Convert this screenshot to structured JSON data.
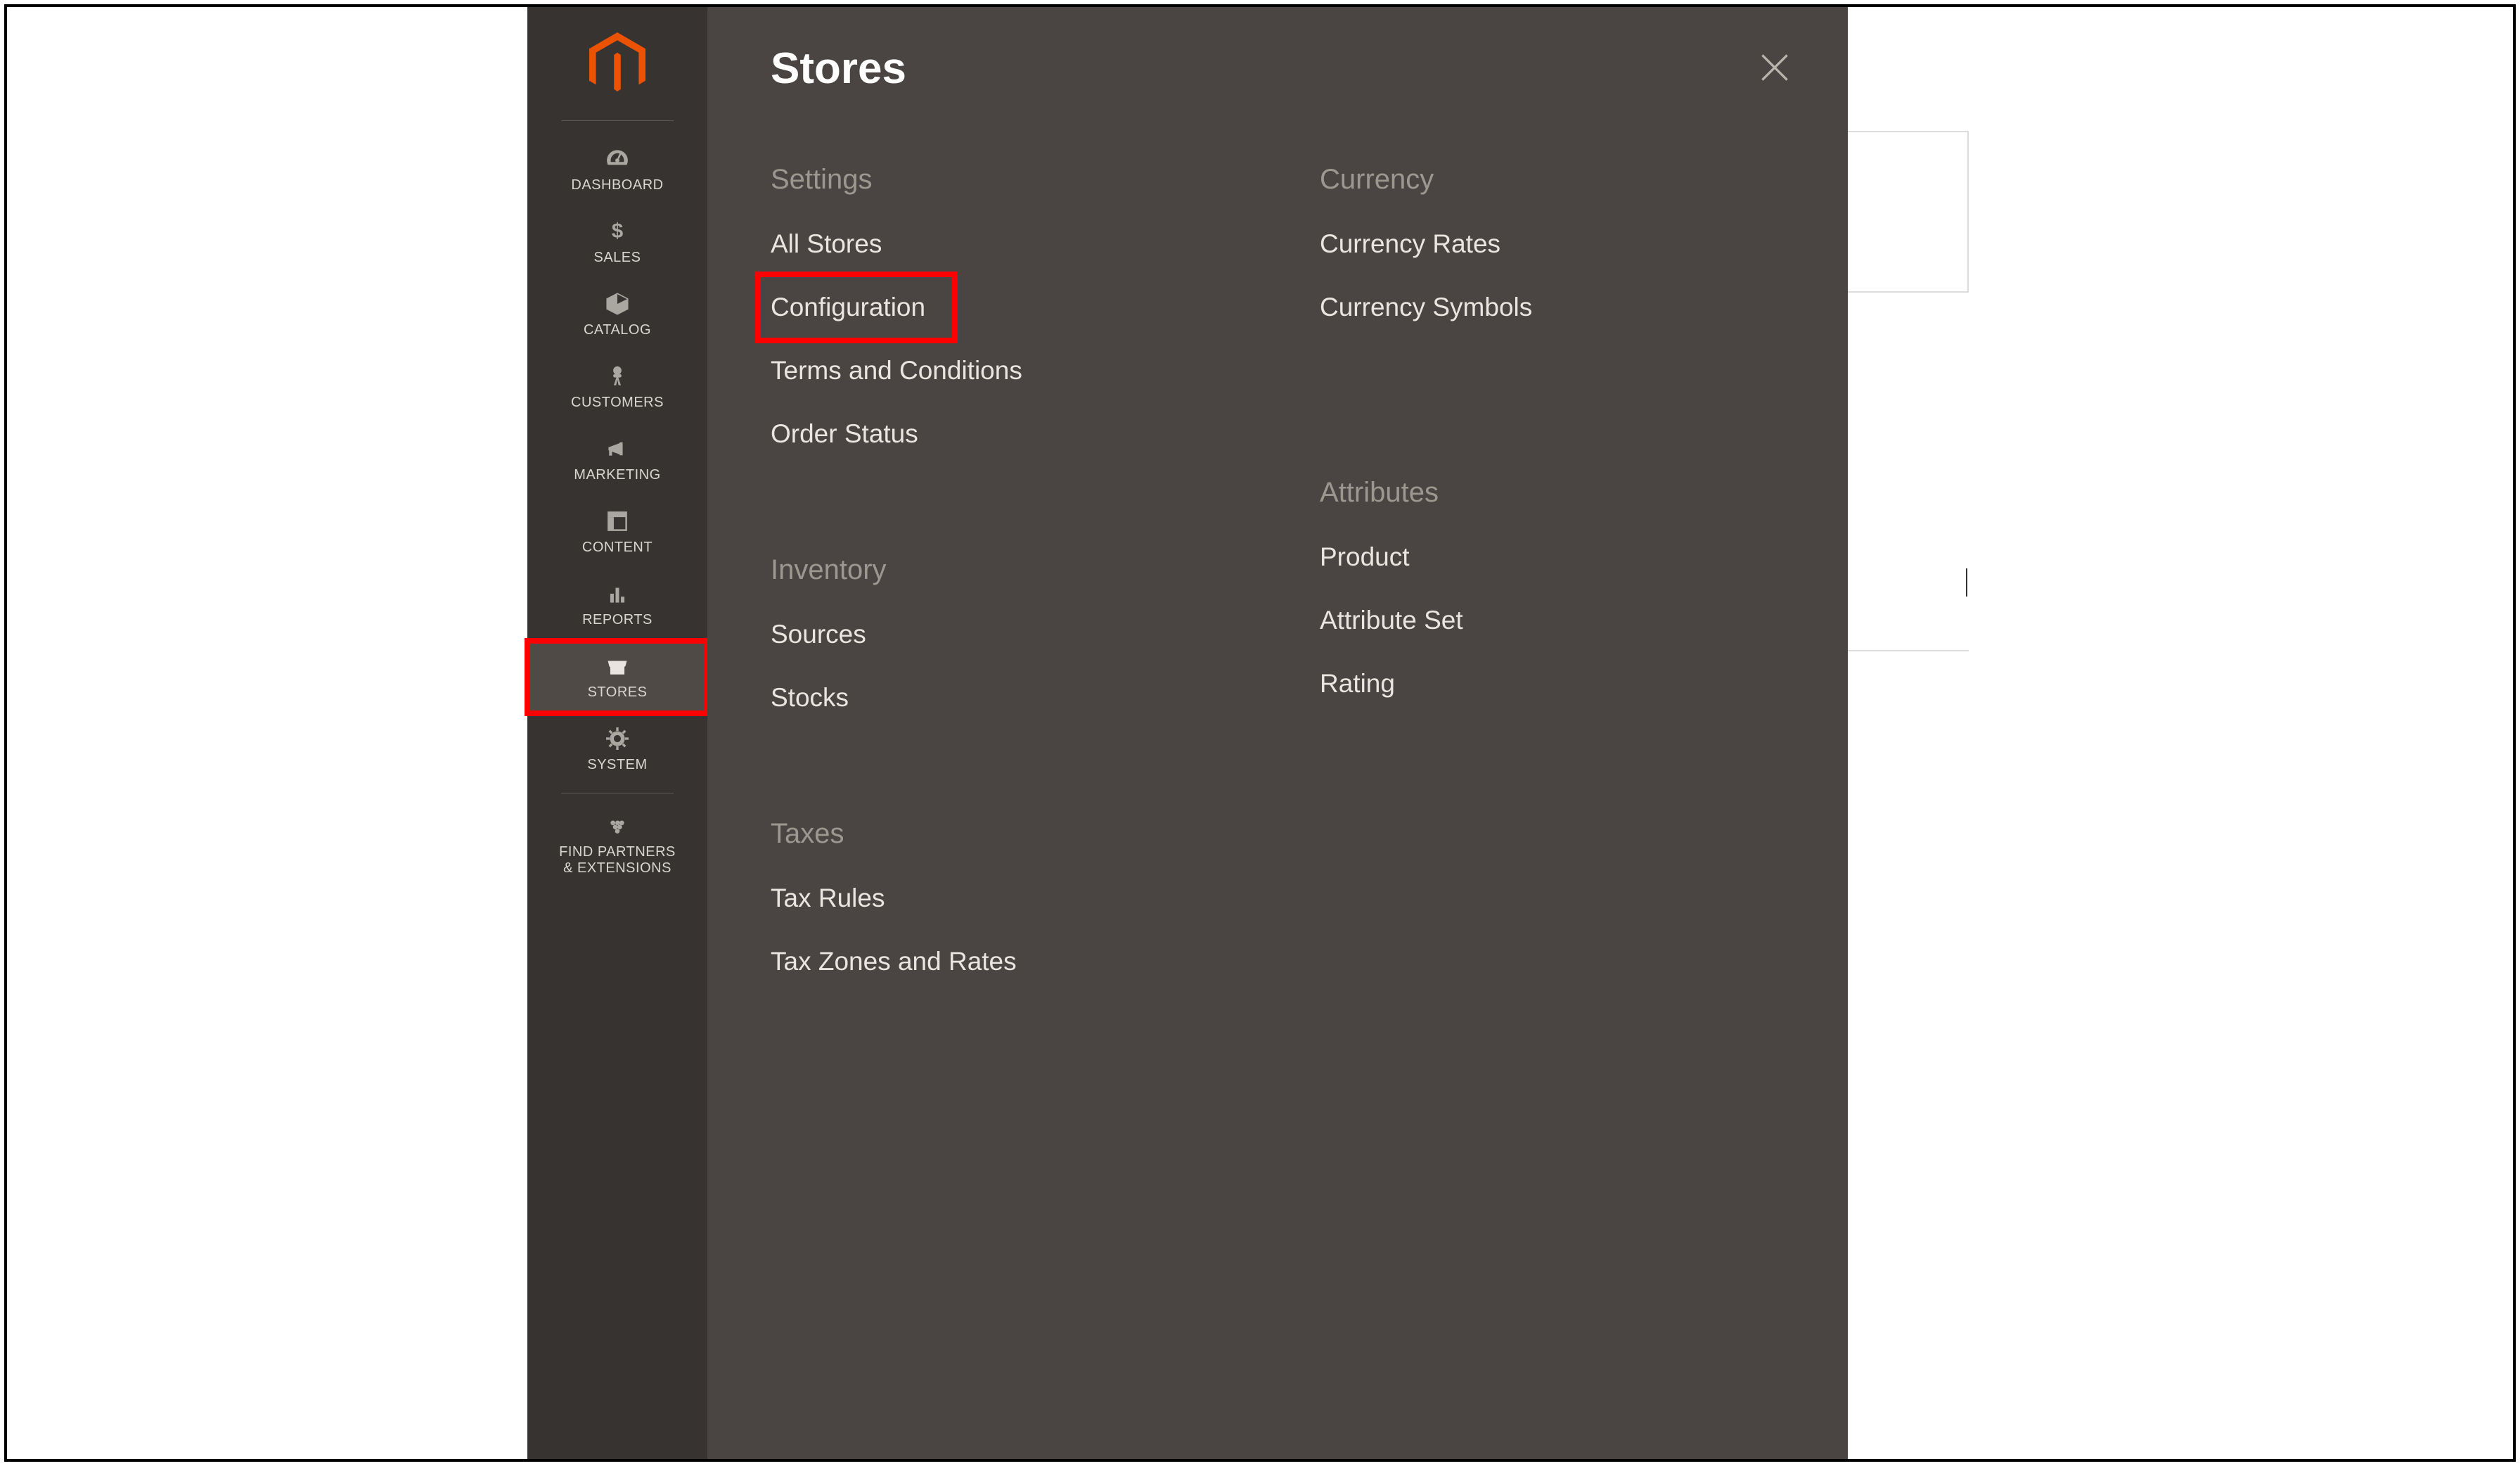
{
  "sidebar": {
    "items": [
      {
        "label": "DASHBOARD"
      },
      {
        "label": "SALES"
      },
      {
        "label": "CATALOG"
      },
      {
        "label": "CUSTOMERS"
      },
      {
        "label": "MARKETING"
      },
      {
        "label": "CONTENT"
      },
      {
        "label": "REPORTS"
      },
      {
        "label": "STORES"
      },
      {
        "label": "SYSTEM"
      },
      {
        "label": "FIND PARTNERS"
      },
      {
        "label_line2": "& EXTENSIONS"
      }
    ]
  },
  "flyout": {
    "title": "Stores",
    "columns": {
      "left": [
        {
          "heading": "Settings",
          "links": [
            "All Stores",
            "Configuration",
            "Terms and Conditions",
            "Order Status"
          ]
        },
        {
          "heading": "Inventory",
          "links": [
            "Sources",
            "Stocks"
          ]
        },
        {
          "heading": "Taxes",
          "links": [
            "Tax Rules",
            "Tax Zones and Rates"
          ]
        }
      ],
      "right": [
        {
          "heading": "Currency",
          "links": [
            "Currency Rates",
            "Currency Symbols"
          ]
        },
        {
          "heading": "Attributes",
          "links": [
            "Product",
            "Attribute Set",
            "Rating"
          ]
        }
      ]
    }
  },
  "highlights": {
    "sidebar_item": "STORES",
    "flyout_link": "Configuration"
  },
  "colors": {
    "brand_orange": "#eb5202",
    "sidebar_bg": "#373330",
    "flyout_bg": "#4a4542",
    "highlight": "#ff0000"
  }
}
